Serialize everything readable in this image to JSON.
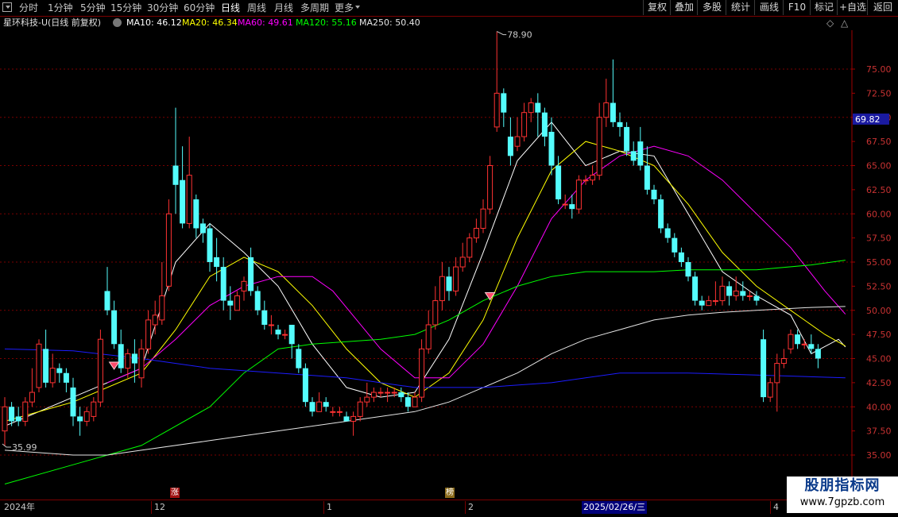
{
  "toolbar": {
    "left_items": [
      "分时",
      "1分钟",
      "5分钟",
      "15分钟",
      "30分钟",
      "60分钟",
      "日线",
      "周线",
      "月线",
      "多周期",
      "更多"
    ],
    "active": "日线",
    "right_items": [
      "复权",
      "叠加",
      "多股",
      "统计",
      "画线",
      "F10",
      "标记",
      "+自选",
      "返回"
    ]
  },
  "legend": {
    "title": "星环科技-U(日线 前复权)",
    "ma10": "MA10: 46.12",
    "ma20": "MA20: 46.34",
    "ma60": "MA60: 49.61",
    "ma120": "MA120: 55.16",
    "ma250": "MA250: 50.40",
    "colors": {
      "ma10": "#ffffff",
      "ma20": "#ffff00",
      "ma60": "#ff00ff",
      "ma120": "#00ff00",
      "ma250": "#e6e6e6",
      "ma_blue": "#1c1cff"
    }
  },
  "date_axis": {
    "labels": [
      "2024年",
      "12",
      "1",
      "2",
      "2025/02/26/三",
      "4"
    ],
    "flags": [
      "涨",
      "榜"
    ]
  },
  "watermark": {
    "line1": "股朋指标网",
    "line2": "www.7gpzb.com"
  },
  "chart_data": {
    "type": "candlestick",
    "ylim": [
      33.5,
      81.5
    ],
    "yticks": [
      "75.00",
      "72.50",
      "70.00",
      "67.50",
      "65.00",
      "62.50",
      "60.00",
      "57.50",
      "55.00",
      "52.50",
      "50.00",
      "47.50",
      "45.00",
      "42.50",
      "40.00",
      "37.50",
      "35.00"
    ],
    "current_price": "69.82",
    "max_label": "78.90",
    "min_label": "35.99",
    "colors": {
      "up": "#ff3232",
      "down": "#54fcfc",
      "grid": "#7a0000"
    },
    "candles": [
      [
        37.5,
        40.0,
        41.0,
        35.99
      ],
      [
        40.0,
        38.5,
        40.5,
        38.0
      ],
      [
        39.0,
        38.5,
        40.0,
        38.0
      ],
      [
        38.5,
        40.5,
        41.0,
        38.0
      ],
      [
        40.5,
        41.5,
        44.0,
        40.0
      ],
      [
        42.0,
        46.5,
        47.0,
        41.5
      ],
      [
        46.0,
        42.5,
        48.0,
        42.0
      ],
      [
        42.5,
        44.0,
        45.5,
        42.0
      ],
      [
        44.0,
        43.5,
        44.5,
        42.5
      ],
      [
        43.5,
        42.5,
        44.0,
        41.5
      ],
      [
        42.0,
        39.0,
        43.0,
        38.0
      ],
      [
        39.0,
        38.5,
        40.0,
        37.0
      ],
      [
        38.5,
        39.5,
        40.0,
        38.0
      ],
      [
        39.0,
        40.5,
        41.0,
        38.5
      ],
      [
        40.5,
        47.0,
        48.0,
        40.0
      ],
      [
        52.0,
        50.0,
        54.5,
        49.5
      ],
      [
        50.0,
        46.5,
        51.0,
        46.0
      ],
      [
        46.5,
        44.0,
        48.0,
        43.5
      ],
      [
        44.0,
        45.5,
        46.0,
        43.0
      ],
      [
        45.5,
        44.5,
        47.0,
        42.5
      ],
      [
        43.0,
        46.0,
        47.0,
        42.0
      ],
      [
        46.0,
        49.0,
        50.0,
        45.5
      ],
      [
        48.5,
        49.5,
        51.0,
        47.5
      ],
      [
        49.0,
        51.5,
        55.0,
        48.5
      ],
      [
        52.5,
        60.0,
        61.5,
        52.0
      ],
      [
        65.0,
        63.0,
        71.0,
        60.0
      ],
      [
        63.5,
        59.0,
        67.0,
        58.5
      ],
      [
        59.0,
        64.0,
        68.0,
        58.5
      ],
      [
        61.5,
        58.5,
        62.0,
        57.5
      ],
      [
        59.0,
        58.0,
        59.5,
        57.0
      ],
      [
        58.5,
        55.0,
        59.0,
        54.0
      ],
      [
        55.5,
        54.5,
        57.5,
        53.0
      ],
      [
        54.5,
        51.0,
        55.5,
        50.0
      ],
      [
        51.0,
        50.5,
        52.5,
        49.0
      ],
      [
        50.0,
        51.5,
        52.0,
        50.0
      ],
      [
        52.0,
        53.0,
        53.5,
        51.0
      ],
      [
        55.5,
        52.0,
        56.5,
        51.5
      ],
      [
        52.0,
        50.0,
        52.5,
        49.5
      ],
      [
        50.0,
        48.5,
        51.0,
        48.0
      ],
      [
        48.5,
        48.5,
        49.5,
        47.5
      ],
      [
        48.0,
        47.5,
        48.5,
        47.0
      ],
      [
        47.5,
        47.5,
        48.0,
        47.0
      ],
      [
        48.5,
        46.5,
        48.5,
        45.0
      ],
      [
        46.0,
        44.0,
        46.5,
        43.5
      ],
      [
        44.0,
        40.5,
        44.5,
        40.0
      ],
      [
        40.5,
        39.5,
        41.0,
        39.0
      ],
      [
        39.5,
        40.5,
        41.5,
        39.5
      ],
      [
        40.5,
        40.0,
        41.0,
        39.5
      ],
      [
        39.5,
        39.5,
        40.0,
        39.0
      ],
      [
        39.5,
        39.5,
        40.0,
        39.0
      ],
      [
        39.0,
        38.5,
        39.5,
        38.5
      ],
      [
        38.5,
        39.0,
        39.5,
        37.0
      ],
      [
        39.0,
        40.5,
        41.0,
        38.5
      ],
      [
        40.5,
        41.0,
        42.5,
        40.0
      ],
      [
        41.0,
        41.5,
        42.0,
        40.5
      ],
      [
        41.5,
        41.5,
        42.0,
        41.0
      ],
      [
        41.5,
        41.5,
        42.0,
        40.5
      ],
      [
        41.5,
        41.5,
        42.0,
        41.0
      ],
      [
        41.5,
        41.0,
        42.0,
        40.5
      ],
      [
        41.0,
        40.0,
        41.5,
        39.5
      ],
      [
        40.0,
        41.0,
        41.5,
        40.0
      ],
      [
        41.0,
        46.0,
        47.0,
        40.5
      ],
      [
        46.0,
        48.5,
        50.0,
        45.5
      ],
      [
        48.5,
        51.0,
        52.5,
        48.0
      ],
      [
        51.0,
        53.5,
        55.0,
        50.0
      ],
      [
        53.5,
        52.0,
        54.5,
        51.0
      ],
      [
        52.0,
        54.5,
        55.5,
        51.5
      ],
      [
        54.5,
        55.5,
        57.0,
        54.0
      ],
      [
        55.5,
        57.5,
        58.0,
        55.0
      ],
      [
        57.5,
        58.5,
        59.5,
        57.0
      ],
      [
        58.5,
        60.5,
        61.5,
        58.0
      ],
      [
        60.5,
        65.0,
        66.0,
        60.0
      ],
      [
        69.0,
        72.5,
        78.9,
        68.5
      ],
      [
        72.5,
        70.5,
        73.0,
        69.0
      ],
      [
        68.0,
        66.0,
        70.0,
        65.0
      ],
      [
        67.0,
        68.0,
        70.0,
        66.5
      ],
      [
        68.0,
        70.5,
        71.5,
        67.5
      ],
      [
        70.5,
        71.5,
        72.0,
        69.5
      ],
      [
        71.5,
        70.5,
        72.5,
        68.0
      ],
      [
        70.5,
        68.0,
        71.0,
        67.0
      ],
      [
        68.5,
        65.0,
        70.0,
        64.0
      ],
      [
        65.0,
        61.5,
        66.0,
        61.0
      ],
      [
        61.0,
        61.0,
        62.0,
        60.5
      ],
      [
        61.0,
        60.5,
        62.0,
        59.5
      ],
      [
        60.5,
        63.5,
        64.0,
        60.0
      ],
      [
        63.5,
        63.5,
        64.0,
        63.0
      ],
      [
        63.5,
        64.0,
        65.0,
        63.0
      ],
      [
        64.0,
        70.0,
        71.5,
        63.5
      ],
      [
        70.0,
        71.5,
        74.0,
        69.0
      ],
      [
        71.5,
        69.5,
        76.0,
        69.0
      ],
      [
        69.5,
        69.0,
        70.5,
        68.0
      ],
      [
        69.0,
        66.5,
        69.5,
        66.0
      ],
      [
        66.5,
        65.5,
        67.5,
        65.0
      ],
      [
        67.5,
        65.0,
        69.0,
        64.5
      ],
      [
        65.0,
        62.5,
        67.0,
        62.0
      ],
      [
        62.5,
        61.5,
        63.0,
        61.0
      ],
      [
        61.5,
        58.5,
        62.0,
        58.0
      ],
      [
        58.5,
        57.5,
        59.0,
        57.0
      ],
      [
        57.5,
        56.0,
        58.0,
        55.5
      ],
      [
        56.0,
        55.0,
        56.5,
        54.5
      ],
      [
        55.0,
        53.5,
        55.5,
        53.0
      ],
      [
        53.5,
        51.0,
        54.0,
        50.5
      ],
      [
        51.0,
        50.5,
        51.5,
        50.0
      ],
      [
        50.5,
        51.0,
        51.5,
        50.5
      ],
      [
        51.0,
        51.0,
        53.0,
        50.5
      ],
      [
        51.0,
        52.5,
        53.5,
        50.5
      ],
      [
        52.5,
        51.5,
        53.0,
        50.5
      ],
      [
        51.5,
        52.0,
        53.5,
        51.0
      ],
      [
        52.0,
        51.5,
        53.0,
        51.0
      ],
      [
        51.5,
        51.5,
        52.0,
        51.0
      ],
      [
        51.5,
        51.0,
        52.0,
        50.5
      ],
      [
        47.0,
        41.0,
        48.0,
        40.5
      ],
      [
        41.0,
        42.5,
        43.0,
        40.5
      ],
      [
        42.5,
        44.5,
        45.5,
        39.5
      ],
      [
        44.5,
        45.0,
        46.0,
        44.0
      ],
      [
        46.0,
        47.5,
        48.0,
        45.5
      ],
      [
        47.5,
        46.5,
        48.0,
        46.0
      ],
      [
        46.5,
        46.5,
        47.0,
        46.0
      ],
      [
        46.5,
        46.0,
        47.5,
        45.5
      ],
      [
        46.0,
        45.0,
        46.5,
        44.0
      ]
    ],
    "candle_x0": 6,
    "candle_dx": 8.6,
    "ma_lines": {
      "ma10": [
        [
          0,
          38.0
        ],
        [
          10,
          41.0
        ],
        [
          20,
          44.0
        ],
        [
          25,
          55.0
        ],
        [
          30,
          59.0
        ],
        [
          35,
          56.0
        ],
        [
          40,
          52.5
        ],
        [
          45,
          46.5
        ],
        [
          50,
          42.0
        ],
        [
          55,
          41.0
        ],
        [
          60,
          41.5
        ],
        [
          65,
          47.0
        ],
        [
          70,
          56.0
        ],
        [
          75,
          65.5
        ],
        [
          80,
          69.5
        ],
        [
          85,
          65.0
        ],
        [
          90,
          66.5
        ],
        [
          95,
          66.0
        ],
        [
          100,
          60.0
        ],
        [
          105,
          54.0
        ],
        [
          110,
          51.5
        ],
        [
          115,
          49.5
        ],
        [
          118,
          45.5
        ],
        [
          122,
          47.0
        ],
        [
          123,
          46.2
        ]
      ],
      "ma20": [
        [
          0,
          38.5
        ],
        [
          10,
          40.5
        ],
        [
          20,
          43.5
        ],
        [
          25,
          48.0
        ],
        [
          30,
          53.5
        ],
        [
          35,
          55.5
        ],
        [
          40,
          54.0
        ],
        [
          45,
          50.5
        ],
        [
          50,
          46.0
        ],
        [
          55,
          42.5
        ],
        [
          60,
          41.0
        ],
        [
          65,
          43.5
        ],
        [
          70,
          49.0
        ],
        [
          75,
          57.5
        ],
        [
          80,
          64.5
        ],
        [
          85,
          67.5
        ],
        [
          90,
          66.5
        ],
        [
          95,
          65.0
        ],
        [
          100,
          61.0
        ],
        [
          105,
          56.0
        ],
        [
          110,
          52.5
        ],
        [
          115,
          50.0
        ],
        [
          120,
          47.5
        ],
        [
          123,
          46.3
        ]
      ],
      "ma60": [
        [
          15,
          42.5
        ],
        [
          20,
          44.0
        ],
        [
          25,
          47.0
        ],
        [
          30,
          50.5
        ],
        [
          35,
          52.5
        ],
        [
          40,
          53.5
        ],
        [
          45,
          53.5
        ],
        [
          48,
          52.0
        ],
        [
          55,
          46.0
        ],
        [
          60,
          43.0
        ],
        [
          65,
          43.0
        ],
        [
          70,
          46.5
        ],
        [
          75,
          52.5
        ],
        [
          80,
          59.5
        ],
        [
          85,
          63.5
        ],
        [
          90,
          66.0
        ],
        [
          95,
          67.0
        ],
        [
          100,
          66.0
        ],
        [
          105,
          63.5
        ],
        [
          110,
          60.0
        ],
        [
          115,
          56.5
        ],
        [
          120,
          52.0
        ],
        [
          123,
          49.6
        ]
      ],
      "ma120": [
        [
          0,
          32.0
        ],
        [
          10,
          34.0
        ],
        [
          20,
          36.0
        ],
        [
          30,
          40.0
        ],
        [
          35,
          43.5
        ],
        [
          40,
          46.0
        ],
        [
          45,
          46.5
        ],
        [
          55,
          47.0
        ],
        [
          60,
          47.5
        ],
        [
          65,
          49.0
        ],
        [
          70,
          51.0
        ],
        [
          75,
          52.5
        ],
        [
          80,
          53.5
        ],
        [
          85,
          54.0
        ],
        [
          90,
          54.0
        ],
        [
          95,
          54.0
        ],
        [
          100,
          54.2
        ],
        [
          110,
          54.2
        ],
        [
          118,
          54.7
        ],
        [
          123,
          55.2
        ]
      ],
      "ma250": [
        [
          0,
          35.5
        ],
        [
          10,
          35.0
        ],
        [
          15,
          35.0
        ],
        [
          20,
          35.5
        ],
        [
          30,
          36.5
        ],
        [
          40,
          37.5
        ],
        [
          50,
          38.5
        ],
        [
          60,
          39.5
        ],
        [
          65,
          40.5
        ],
        [
          70,
          42.0
        ],
        [
          75,
          43.5
        ],
        [
          80,
          45.5
        ],
        [
          85,
          47.0
        ],
        [
          90,
          48.0
        ],
        [
          95,
          49.0
        ],
        [
          100,
          49.5
        ],
        [
          105,
          49.8
        ],
        [
          110,
          50.0
        ],
        [
          118,
          50.3
        ],
        [
          123,
          50.4
        ]
      ],
      "ma_blue": [
        [
          0,
          46.0
        ],
        [
          10,
          45.8
        ],
        [
          20,
          45.0
        ],
        [
          30,
          44.0
        ],
        [
          40,
          43.5
        ],
        [
          50,
          43.0
        ],
        [
          60,
          42.0
        ],
        [
          70,
          42.0
        ],
        [
          80,
          42.5
        ],
        [
          85,
          43.0
        ],
        [
          90,
          43.5
        ],
        [
          100,
          43.5
        ],
        [
          110,
          43.3
        ],
        [
          123,
          43.0
        ]
      ]
    }
  }
}
